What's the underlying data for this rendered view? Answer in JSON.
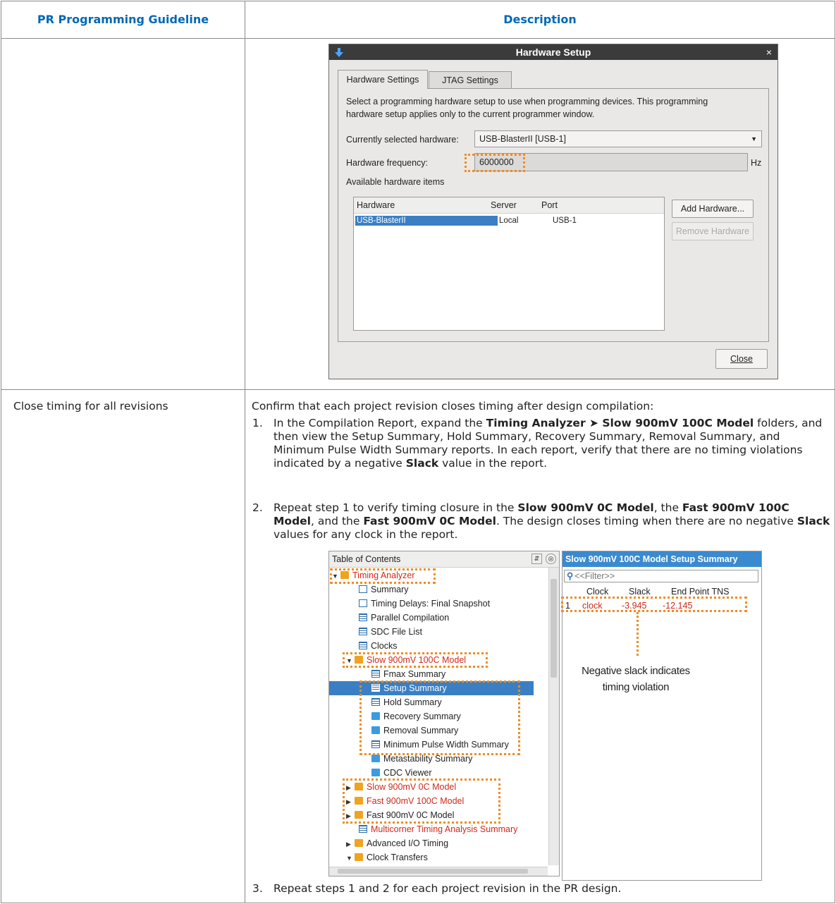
{
  "table": {
    "col1_header": "PR Programming Guideline",
    "col2_header": "Description",
    "row2_guideline": "Close timing for all revisions"
  },
  "hardware_setup": {
    "title": "Hardware Setup",
    "close_x": "×",
    "tab_hw": "Hardware Settings",
    "tab_jtag": "JTAG Settings",
    "desc": "Select a programming hardware setup to use when programming devices. This programming hardware setup applies only to the current programmer window.",
    "current_label": "Currently selected hardware:",
    "current_value": "USB-BlasterII [USB-1]",
    "freq_label": "Hardware frequency:",
    "freq_value": "6000000",
    "freq_unit": "Hz",
    "available_label": "Available hardware items",
    "col_hardware": "Hardware",
    "col_server": "Server",
    "col_port": "Port",
    "row_hardware": "USB-BlasterII",
    "row_server": "Local",
    "row_port": "USB-1",
    "add_button": "Add Hardware...",
    "remove_button": "Remove Hardware",
    "close_button": "Close"
  },
  "steps": {
    "intro": "Confirm that each project revision closes timing after design compilation:",
    "s1_num": "1.",
    "s2_num": "2.",
    "s3_num": "3.",
    "s3": "Repeat steps 1 and 2 for each project revision in the PR design."
  },
  "toc": {
    "header": "Table of Contents",
    "items": [
      "Timing Analyzer",
      "Summary",
      "Timing Delays: Final Snapshot",
      "Parallel Compilation",
      "SDC File List",
      "Clocks",
      "Slow 900mV 100C Model",
      "Fmax Summary",
      "Setup Summary",
      "Hold Summary",
      "Recovery Summary",
      "Removal Summary",
      "Minimum Pulse Width Summary",
      "Metastability Summary",
      "CDC Viewer",
      "Slow 900mV 0C Model",
      "Fast 900mV 100C Model",
      "Fast 900mV 0C Model",
      "Multicorner Timing Analysis Summary",
      "Advanced I/O Timing",
      "Clock Transfers"
    ]
  },
  "setup_summary": {
    "header": "Slow 900mV 100C Model Setup Summary",
    "filter": "<<Filter>>",
    "col_clock": "Clock",
    "col_slack": "Slack",
    "col_tns": "End Point TNS",
    "row_num": "1",
    "row_clock": "clock",
    "row_slack": "-3.945",
    "row_tns": "-12.145",
    "callout_line1": "Negative slack indicates",
    "callout_line2": "timing violation"
  },
  "colors": {
    "header_blue": "#0068b5",
    "highlight_orange": "#f08c1e",
    "selection_blue": "#3a7fc4",
    "error_red": "#d2281c"
  }
}
